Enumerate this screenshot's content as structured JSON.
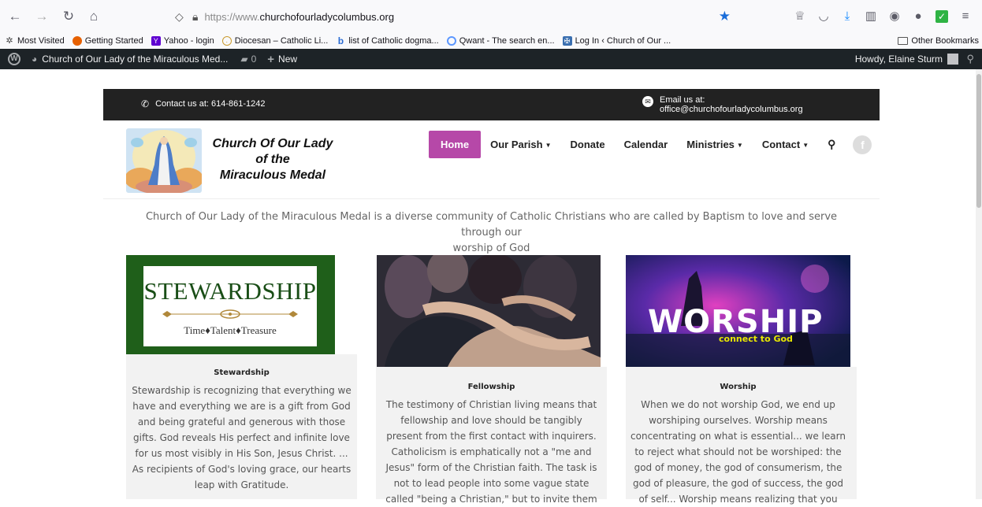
{
  "browser": {
    "url_prefix": "https://www.",
    "url_domain": "churchofourladycolumbus.org",
    "bookmarks": [
      {
        "label": "Most Visited",
        "color": "#666"
      },
      {
        "label": "Getting Started",
        "color": "#e66000"
      },
      {
        "label": "Yahoo - login",
        "color": "#5f01d1"
      },
      {
        "label": "Diocesan – Catholic Li...",
        "color": "#c99a2e"
      },
      {
        "label": "list of Catholic dogma...",
        "color": "#2b6cd4"
      },
      {
        "label": "Qwant - The search en...",
        "color": "#5c97ff"
      },
      {
        "label": "Log In ‹ Church of Our ...",
        "color": "#3a6fb0"
      }
    ],
    "other_bookmarks": "Other Bookmarks"
  },
  "wp_admin": {
    "site_name": "Church of Our Lady of the Miraculous Med...",
    "comments_count": "0",
    "new_label": "New",
    "howdy": "Howdy, Elaine Sturm"
  },
  "site": {
    "contact_phone": "Contact us at: 614-861-1242",
    "email_line1": "Email us at:",
    "email_line2": "office@churchofourladycolumbus.org",
    "logo_line1": "Church Of Our Lady",
    "logo_line2": "of the",
    "logo_line3": "Miraculous Medal",
    "menu": {
      "home": "Home",
      "parish": "Our Parish",
      "donate": "Donate",
      "calendar": "Calendar",
      "ministries": "Ministries",
      "contact": "Contact"
    },
    "intro_line1": "Church of Our Lady of the Miraculous Medal is a diverse community of Catholic Christians who are called by Baptism to love and serve through our",
    "intro_line2": "worship of God",
    "cards": [
      {
        "image_text": "STEWARDSHIP",
        "image_tagline": "Time♦Talent♦Treasure",
        "title": "Stewardship",
        "lines": [
          "Stewardship is recognizing that everything we",
          "have and everything we are is a gift from God",
          "and being grateful and generous with those",
          "gifts. God reveals His perfect and infinite love",
          "for us most visibly in His Son, Jesus Christ. ...",
          "As recipients of God's loving grace, our hearts",
          "leap with Gratitude."
        ]
      },
      {
        "title": "Fellowship",
        "lines": [
          "The testimony of Christian living means that",
          "fellowship and love should be tangibly",
          "present from the first contact with inquirers.",
          "Catholicism is emphatically not a \"me and",
          "Jesus\" form of the Christian faith. The task is",
          "not to lead people into some vague state",
          "called \"being a Christian,\" but to invite them"
        ]
      },
      {
        "image_text": "WORSHIP",
        "image_tagline": "connect to God",
        "title": "Worship",
        "lines": [
          "When we do not worship God, we end up",
          "worshiping ourselves. Worship means",
          "concentrating on what is essential... we learn",
          "to reject what should not be worshiped: the",
          "god of money, the god of consumerism, the",
          "god of pleasure, the god of success, the god",
          "of self... Worship means realizing that you"
        ]
      }
    ]
  }
}
